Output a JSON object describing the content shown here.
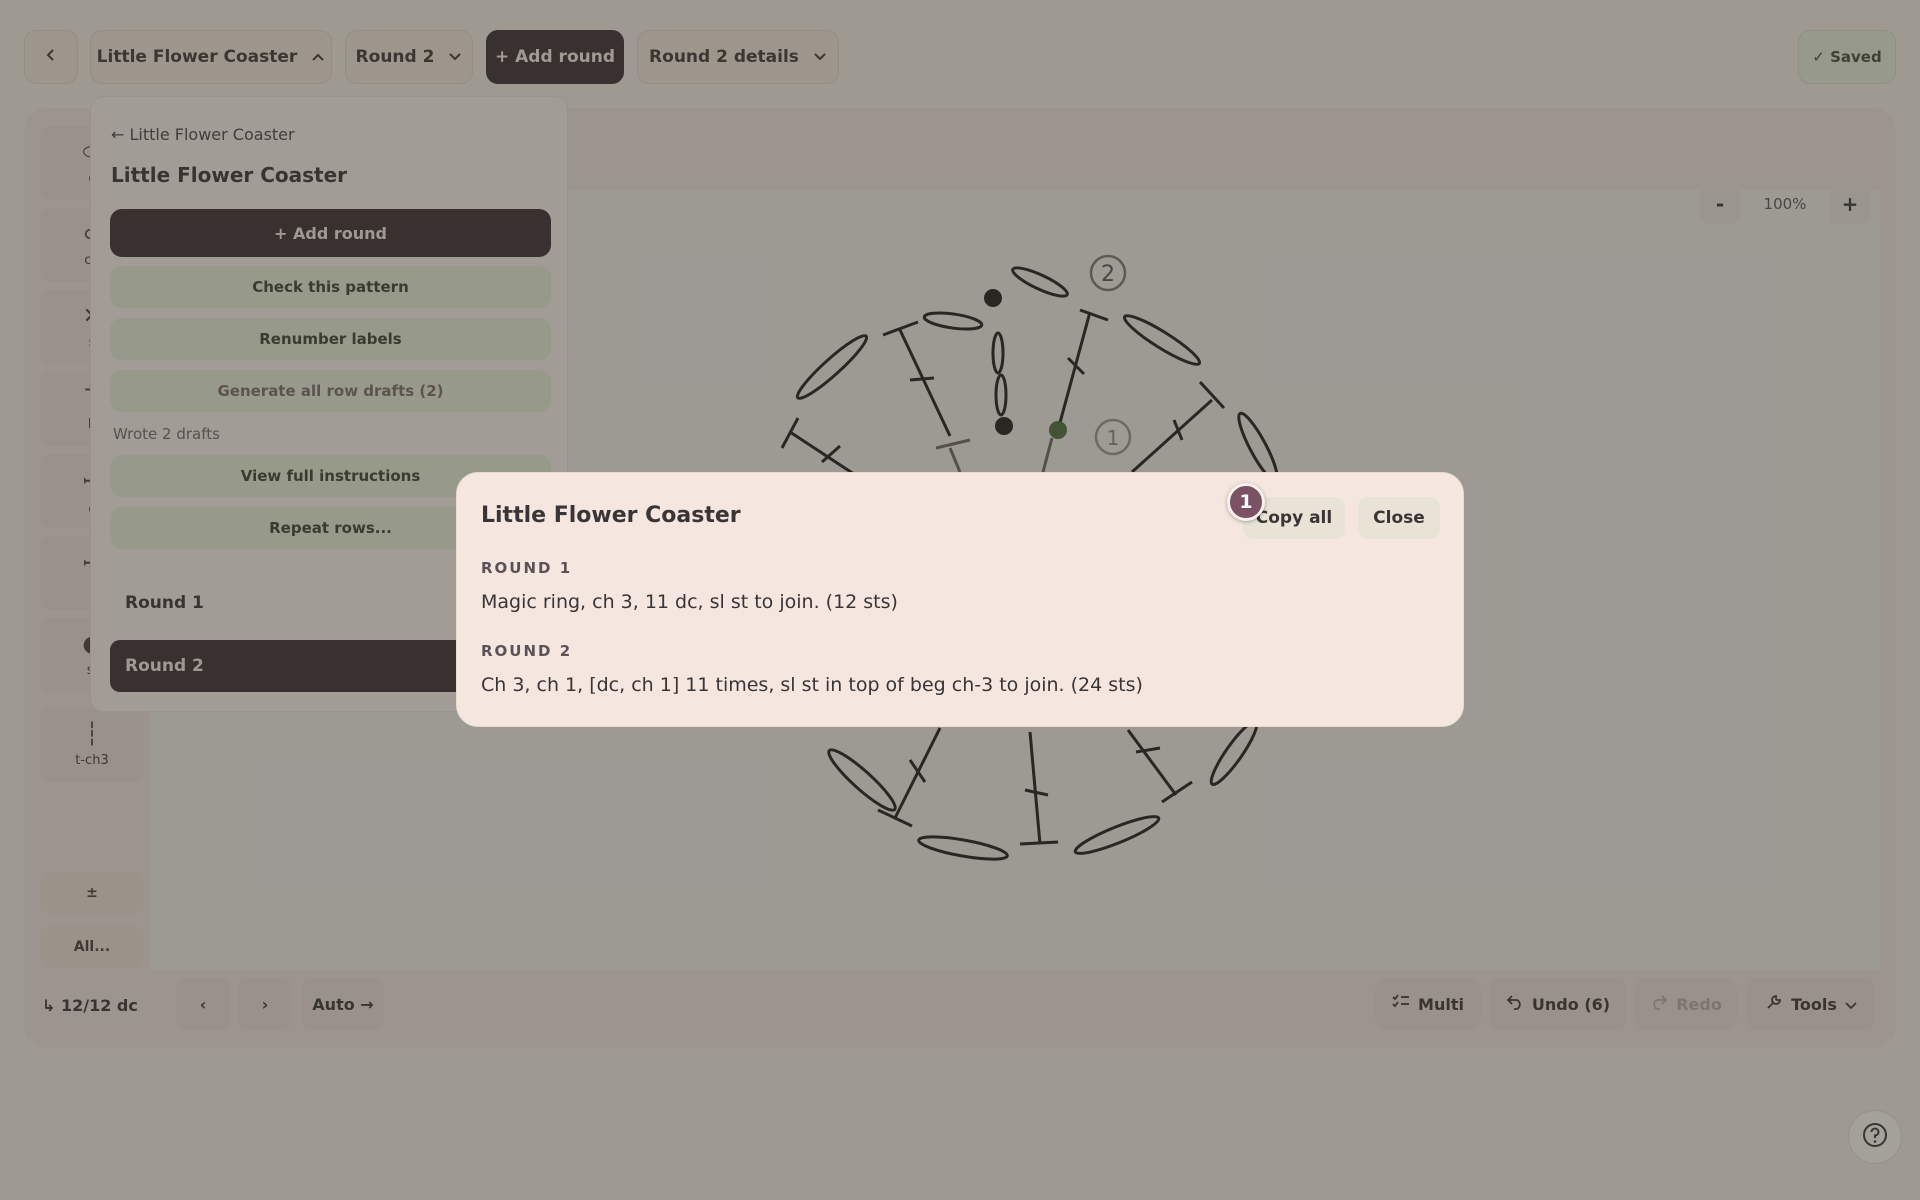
{
  "topbar": {
    "back_icon": "chevron-left-icon",
    "pattern_label": "Little Flower Coaster",
    "round_label": "Round 2",
    "add_round_label": "+ Add round",
    "details_label": "Round 2 details",
    "saved_label": "✓ Saved"
  },
  "dropdown": {
    "back_label": "← Little Flower Coaster",
    "title": "Little Flower Coaster",
    "add_round_label": "+ Add round",
    "check_label": "Check this pattern",
    "renumber_label": "Renumber labels",
    "generate_label": "Generate all row drafts (2)",
    "note": "Wrote 2 drafts",
    "view_label": "View full instructions",
    "repeat_label": "Repeat rows...",
    "rounds": [
      "Round 1",
      "Round 2"
    ],
    "active_round": "Round 2"
  },
  "palette": {
    "items": [
      {
        "glyph": "⬭",
        "label": "c"
      },
      {
        "glyph": "⊂",
        "label": "ch"
      },
      {
        "glyph": "✕",
        "label": "s"
      },
      {
        "glyph": "T",
        "label": "h"
      },
      {
        "glyph": "ꟷ",
        "label": "c"
      },
      {
        "glyph": "ꟷ",
        "label": "t"
      },
      {
        "glyph": "●",
        "label": "sl"
      },
      {
        "glyph": "┆",
        "label": "t-ch3"
      }
    ],
    "plusminus_label": "±",
    "all_label": "All..."
  },
  "zoom": {
    "minus": "-",
    "value": "100%",
    "plus": "+"
  },
  "diagram": {
    "round_labels": [
      "2",
      "1"
    ]
  },
  "bottombar": {
    "status": "↳ 12/12 dc",
    "prev": "‹",
    "next": "›",
    "auto_label": "Auto →",
    "multi_label": "Multi",
    "undo_label": "Undo (6)",
    "redo_label": "Redo",
    "tools_label": "Tools"
  },
  "modal": {
    "title": "Little Flower Coaster",
    "copy_label": "Copy all",
    "close_label": "Close",
    "step_badge": "1",
    "sections": [
      {
        "label": "ROUND 1",
        "text": "Magic ring, ch 3, 11 dc, sl st to join. (12 sts)"
      },
      {
        "label": "ROUND 2",
        "text": "Ch 3, ch 1, [dc, ch 1] 11 times, sl st in top of beg ch-3 to join. (24 sts)"
      }
    ]
  },
  "help": {
    "icon": "help-circle-icon"
  },
  "colors": {
    "accent_dark": "#3b2a33",
    "badge": "#7b5164",
    "highlight_stitch": "#4f6b3f"
  }
}
